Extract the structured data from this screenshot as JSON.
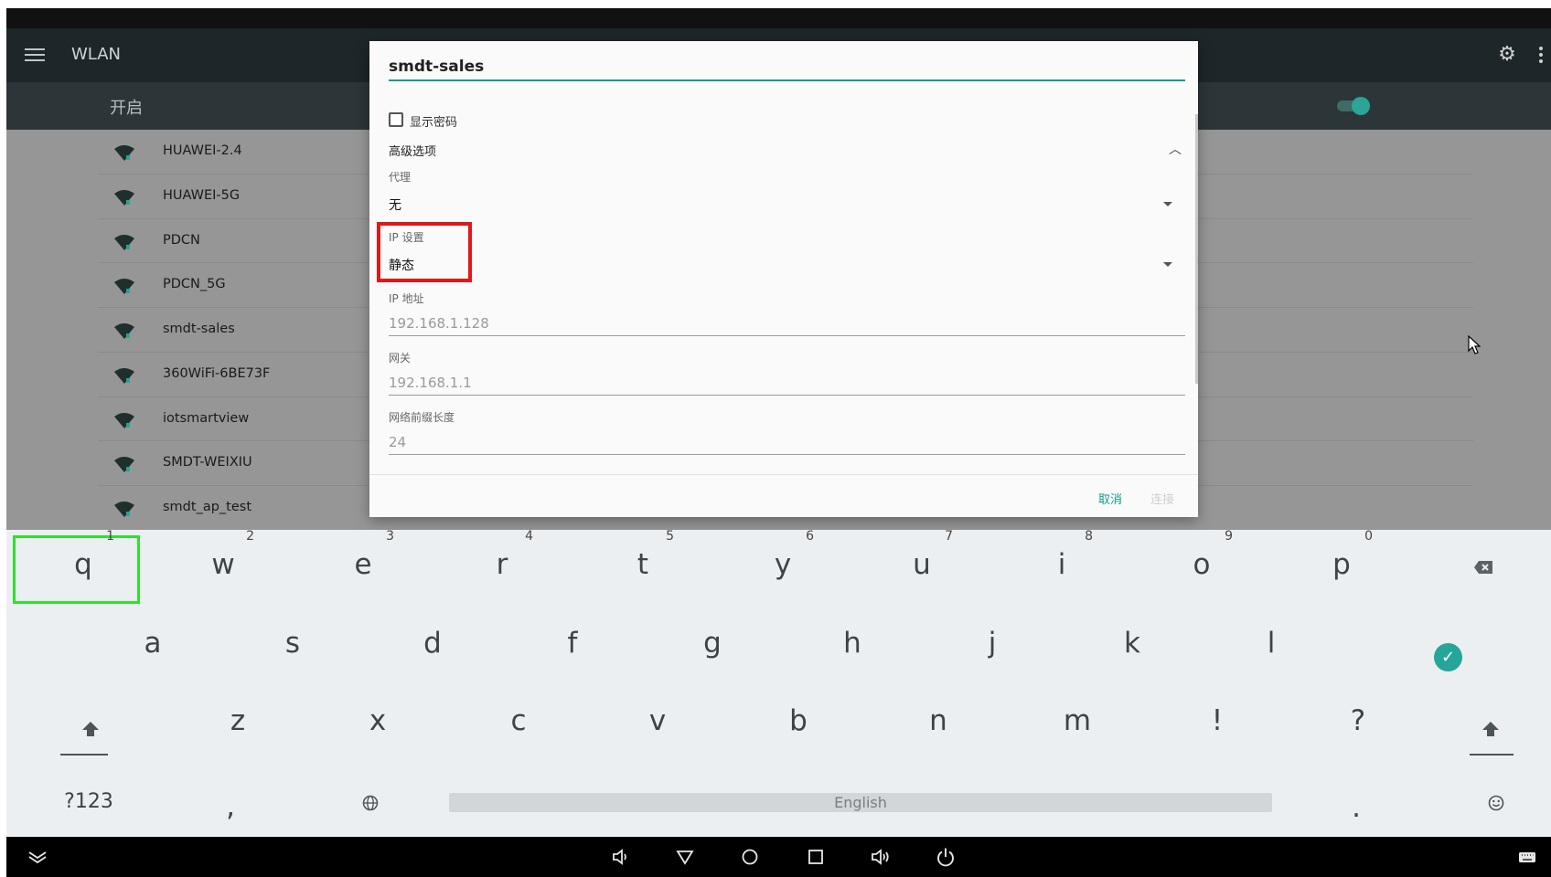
{
  "header": {
    "title": "WLAN"
  },
  "switchbar": {
    "label": "开启",
    "enabled": true
  },
  "networks": [
    "HUAWEI-2.4",
    "HUAWEI-5G",
    "PDCN",
    "PDCN_5G",
    "smdt-sales",
    "360WiFi-6BE73F",
    "iotsmartview",
    "SMDT-WEIXIU",
    "smdt_ap_test"
  ],
  "dialog": {
    "ssid": "smdt-sales",
    "show_password_label": "显示密码",
    "advanced_label": "高级选项",
    "proxy_label": "代理",
    "proxy_value": "无",
    "ip_settings_label": "IP 设置",
    "ip_settings_value": "静态",
    "ip_address_label": "IP 地址",
    "ip_address_placeholder": "192.168.1.128",
    "gateway_label": "网关",
    "gateway_placeholder": "192.168.1.1",
    "prefix_label": "网络前缀长度",
    "prefix_placeholder": "24",
    "cancel_label": "取消",
    "connect_label": "连接"
  },
  "keyboard": {
    "row1": [
      {
        "key": "q",
        "hint": "1"
      },
      {
        "key": "w",
        "hint": "2"
      },
      {
        "key": "e",
        "hint": "3"
      },
      {
        "key": "r",
        "hint": "4"
      },
      {
        "key": "t",
        "hint": "5"
      },
      {
        "key": "y",
        "hint": "6"
      },
      {
        "key": "u",
        "hint": "7"
      },
      {
        "key": "i",
        "hint": "8"
      },
      {
        "key": "o",
        "hint": "9"
      },
      {
        "key": "p",
        "hint": "0"
      }
    ],
    "row2": [
      "a",
      "s",
      "d",
      "f",
      "g",
      "h",
      "j",
      "k",
      "l"
    ],
    "row3": [
      "z",
      "x",
      "c",
      "v",
      "b",
      "n",
      "m",
      "!",
      "?"
    ],
    "symbols_label": "?123",
    "comma": ",",
    "period": ".",
    "space_label": "English",
    "accent": "#26a69a",
    "focus_color": "#2fe02f"
  }
}
